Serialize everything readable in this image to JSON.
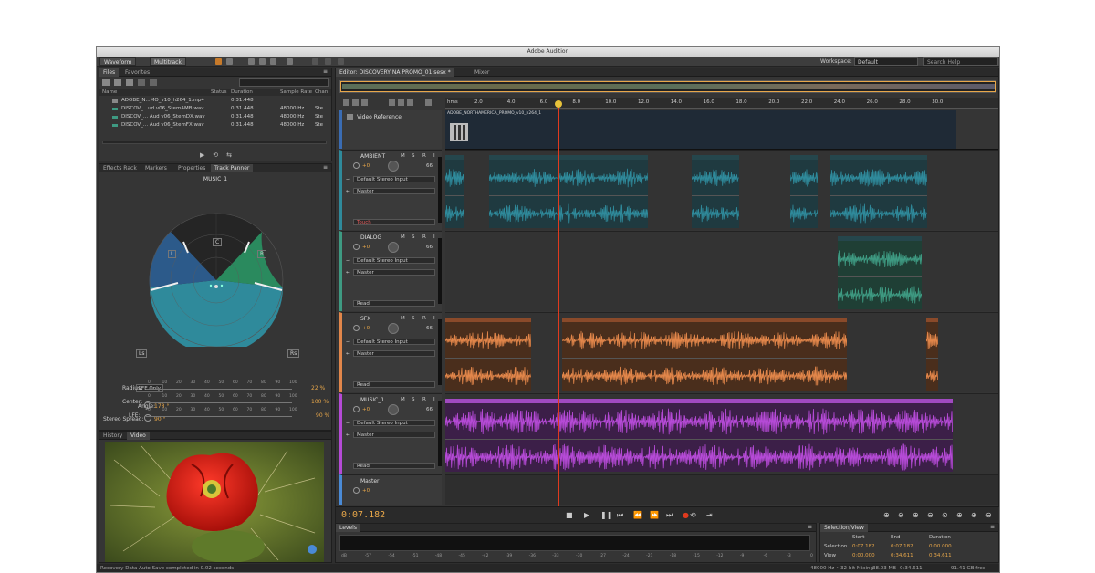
{
  "app": {
    "title": "Adobe Audition"
  },
  "toolbar": {
    "waveform": "Waveform",
    "multitrack": "Multitrack",
    "workspace_label": "Workspace:",
    "workspace_value": "Default",
    "search_placeholder": "Search Help"
  },
  "files": {
    "tabs": [
      "Files",
      "Favorites"
    ],
    "columns": [
      "Name",
      "Status",
      "Duration",
      "Sample Rate",
      "Chan"
    ],
    "rows": [
      {
        "name": "ADOBE_N...MO_v10_h264_1.mp4",
        "duration": "0:31.448",
        "rate": "",
        "chan": ""
      },
      {
        "name": "DISCOV_...ud v06_StemAMB.wav",
        "duration": "0:31.448",
        "rate": "48000 Hz",
        "chan": "Ste"
      },
      {
        "name": "DISCOV_... Aud v06_StemDX.wav",
        "duration": "0:31.448",
        "rate": "48000 Hz",
        "chan": "Ste"
      },
      {
        "name": "DISCOV_... Aud v06_StemFX.wav",
        "duration": "0:31.448",
        "rate": "48000 Hz",
        "chan": "Ste"
      }
    ]
  },
  "panner": {
    "tabs": [
      "Effects Rack",
      "Markers",
      "Properties",
      "Track Panner"
    ],
    "track": "MUSIC_1",
    "labels": {
      "L": "L",
      "C": "C",
      "R": "R",
      "Ls": "Ls",
      "Rs": "Rs"
    },
    "lfe_button": "LFE Only",
    "angle_label": "Angle:",
    "angle_value": "178 °",
    "spread_label": "Stereo Spread:",
    "spread_value": "90 °",
    "radius_label": "Radius:",
    "radius_value": "22 %",
    "center_label": "Center:",
    "center_value": "100 %",
    "lfe_label": "LFE:",
    "lfe_value": "90 %",
    "scale": [
      "0",
      "10",
      "20",
      "30",
      "40",
      "50",
      "60",
      "70",
      "80",
      "90",
      "100"
    ]
  },
  "video": {
    "tabs": [
      "History",
      "Video"
    ]
  },
  "editor": {
    "tab": "Editor: DISCOVERY NA PROMO_01.sesx *",
    "mixer_tab": "Mixer"
  },
  "ruler": {
    "unit": "hms",
    "ticks": [
      "2.0",
      "4.0",
      "6.0",
      "8.0",
      "10.0",
      "12.0",
      "14.0",
      "16.0",
      "18.0",
      "20.0",
      "22.0",
      "24.0",
      "26.0",
      "28.0",
      "30.0"
    ]
  },
  "tracks": {
    "video": {
      "name": "Video Reference",
      "clip": "ADOBE_NORTHAMERICA_PROMO_v10_h264_1"
    },
    "ambient": {
      "name": "AMBIENT",
      "vol": "+0",
      "pan": "66",
      "input": "Default Stereo Input",
      "output": "Master",
      "mode": "Touch"
    },
    "dialog": {
      "name": "DIALOG",
      "vol": "+0",
      "pan": "66",
      "input": "Default Stereo Input",
      "output": "Master",
      "mode": "Read"
    },
    "sfx": {
      "name": "SFX",
      "vol": "+0",
      "pan": "66",
      "input": "Default Stereo Input",
      "output": "Master",
      "mode": "Read"
    },
    "music": {
      "name": "MUSIC_1",
      "vol": "+0",
      "pan": "66",
      "input": "Default Stereo Input",
      "output": "Master",
      "mode": "Read"
    },
    "master": {
      "name": "Master",
      "vol": "+0"
    }
  },
  "clips": {
    "amb1": "...AMB",
    "amb2": "DISCOV..._D Aud v06_StemAMB",
    "amb3": "...wAMB",
    "amb4": "...AMB",
    "amb5": "DISCOV_PROMO Aud v06_StemAMB",
    "dlg": "DISCOV_PROMO Aud v06_StemDX",
    "sfx1": "DISCOV_PROMO Aud v06_StemFX",
    "sfx2": "DISCOV_PROMO Aud v06_StemFX",
    "sfx_vol": "Volume",
    "sfx3": "...FX",
    "music": "DISCOV_PROMO Aud v06_StemMX_1",
    "music_vol": "Volume"
  },
  "transport": {
    "time": "0:07.182"
  },
  "levels": {
    "tab": "Levels",
    "scale": [
      "dB",
      "-57",
      "-54",
      "-51",
      "-48",
      "-45",
      "-42",
      "-39",
      "-36",
      "-33",
      "-30",
      "-27",
      "-24",
      "-21",
      "-18",
      "-15",
      "-12",
      "-9",
      "-6",
      "-3",
      "0"
    ]
  },
  "selection": {
    "tab": "Selection/View",
    "headers": [
      "Start",
      "End",
      "Duration"
    ],
    "selection_label": "Selection",
    "sel_start": "0:07.182",
    "sel_end": "0:07.182",
    "sel_dur": "0:00.000",
    "view_label": "View",
    "view_start": "0:00.000",
    "view_end": "0:34.611",
    "view_dur": "0:34.611"
  },
  "status": {
    "left": "Recovery Data Auto Save completed in 0.02 seconds",
    "rate": "48000 Hz • 32-bit Mixing",
    "mem": "38.03 MB",
    "time": "0:34.611",
    "free": "91.41 GB free"
  },
  "colors": {
    "ambient": "#2f8a9b",
    "dialog": "#3e9a82",
    "sfx": "#e2864a",
    "music": "#b54ad6",
    "playhead": "#e03a1e",
    "accent": "#e8a74a"
  }
}
